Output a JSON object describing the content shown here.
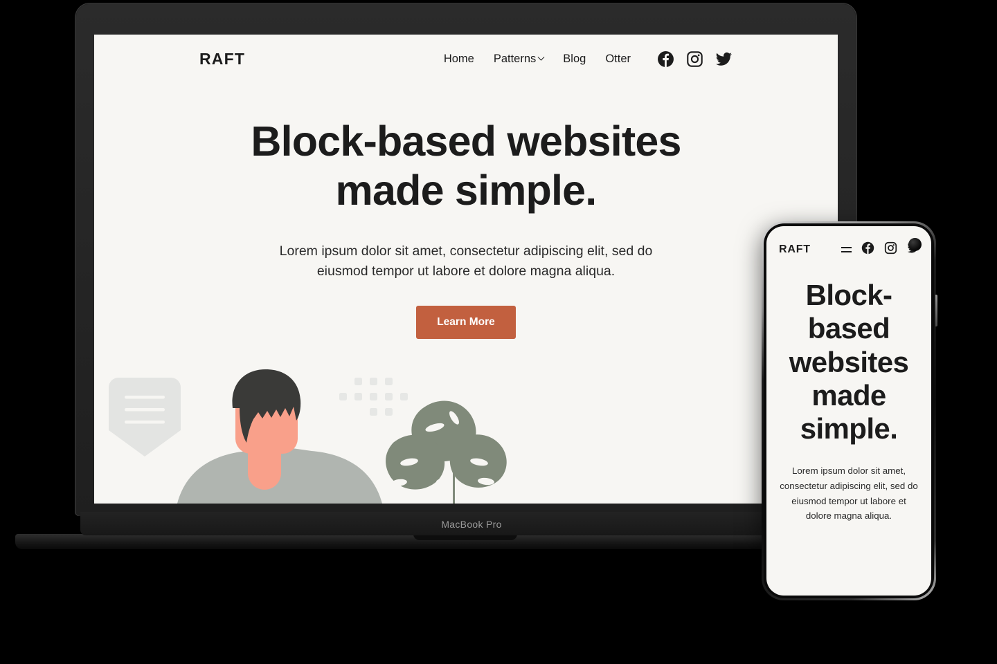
{
  "device_laptop": {
    "brand_label": "MacBook Pro"
  },
  "site": {
    "logo": "RAFT",
    "nav": [
      {
        "label": "Home",
        "has_chevron": false
      },
      {
        "label": "Patterns",
        "has_chevron": true
      },
      {
        "label": "Blog",
        "has_chevron": false
      },
      {
        "label": "Otter",
        "has_chevron": false
      }
    ],
    "social": [
      {
        "name": "facebook-icon",
        "label": "Facebook"
      },
      {
        "name": "instagram-icon",
        "label": "Instagram"
      },
      {
        "name": "twitter-icon",
        "label": "Twitter"
      }
    ],
    "hero": {
      "title": "Block-based websites made simple.",
      "subtitle": "Lorem ipsum dolor sit amet, consectetur adipiscing elit, sed do eiusmod tempor ut labore et dolore magna aliqua.",
      "cta_label": "Learn More"
    },
    "illustration": {
      "name": "person-plant-illustration",
      "elements": [
        "shield-menu-icon",
        "person-figure",
        "dot-grid",
        "monstera-plant"
      ]
    }
  },
  "phone": {
    "logo": "RAFT",
    "menu_icon": "hamburger-icon",
    "social": [
      {
        "name": "facebook-icon",
        "label": "Facebook"
      },
      {
        "name": "instagram-icon",
        "label": "Instagram"
      },
      {
        "name": "twitter-icon",
        "label": "Twitter"
      }
    ],
    "hero": {
      "title": "Block-based websites made simple.",
      "subtitle": "Lorem ipsum dolor sit amet, consectetur adipiscing elit, sed do eiusmod tempor ut labore et dolore magna aliqua."
    }
  },
  "colors": {
    "page_background": "#000000",
    "screen_background": "#f7f6f3",
    "text": "#1c1c1c",
    "accent_button": "#c2603f",
    "plant_green": "#808a7a",
    "skin": "#f9a08a",
    "shirt": "#b0b5b0",
    "hair": "#3a3a38",
    "placeholder_grey": "#e3e4e2"
  }
}
